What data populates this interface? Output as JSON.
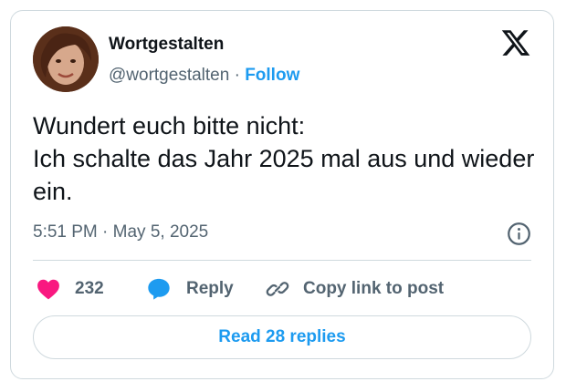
{
  "author": {
    "name": "Wortgestalten",
    "handle": "@wortgestalten",
    "separator": "·",
    "follow_label": "Follow"
  },
  "tweet": {
    "text": "Wundert euch bitte nicht:\nIch schalte das Jahr 2025 mal aus und wieder ein.",
    "timestamp": "5:51 PM · May 5, 2025"
  },
  "actions": {
    "like_count": "232",
    "reply_label": "Reply",
    "copy_label": "Copy link to post"
  },
  "read_replies_label": "Read 28 replies",
  "icons": {
    "brand": "x-logo-icon",
    "info": "info-icon",
    "like": "heart-icon",
    "reply": "speech-bubble-icon",
    "copy": "link-icon"
  },
  "colors": {
    "accent": "#1d9bf0",
    "like": "#f91880",
    "secondary_text": "#536471",
    "border": "#cfd9de"
  }
}
